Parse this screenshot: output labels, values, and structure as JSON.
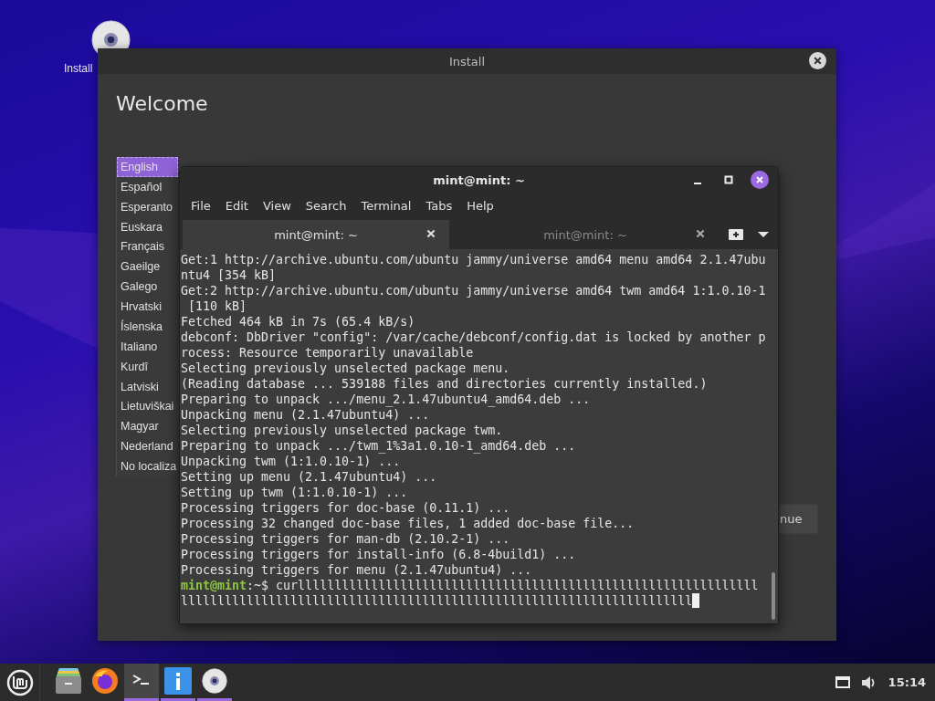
{
  "desktop": {
    "icons": [
      {
        "label": "Install"
      }
    ]
  },
  "installer": {
    "title": "Install",
    "heading": "Welcome",
    "languages": [
      {
        "label": "English",
        "selected": true
      },
      {
        "label": "Español",
        "selected": false
      },
      {
        "label": "Esperanto",
        "selected": false
      },
      {
        "label": "Euskara",
        "selected": false
      },
      {
        "label": "Français",
        "selected": false
      },
      {
        "label": "Gaeilge",
        "selected": false
      },
      {
        "label": "Galego",
        "selected": false
      },
      {
        "label": "Hrvatski",
        "selected": false
      },
      {
        "label": "Íslenska",
        "selected": false
      },
      {
        "label": "Italiano",
        "selected": false
      },
      {
        "label": "Kurdî",
        "selected": false
      },
      {
        "label": "Latviski",
        "selected": false
      },
      {
        "label": "Lietuviškai",
        "selected": false
      },
      {
        "label": "Magyar",
        "selected": false
      },
      {
        "label": "Nederland",
        "selected": false
      },
      {
        "label": "No localiza",
        "selected": false
      }
    ],
    "continue_button": "nue"
  },
  "terminal": {
    "title": "mint@mint: ~",
    "menu": [
      "File",
      "Edit",
      "View",
      "Search",
      "Terminal",
      "Tabs",
      "Help"
    ],
    "tabs": [
      {
        "label": "mint@mint: ~",
        "selected": true
      },
      {
        "label": "mint@mint: ~",
        "selected": false
      }
    ],
    "output": [
      "Get:1 http://archive.ubuntu.com/ubuntu jammy/universe amd64 menu amd64 2.1.47ubu",
      "ntu4 [354 kB]",
      "Get:2 http://archive.ubuntu.com/ubuntu jammy/universe amd64 twm amd64 1:1.0.10-1",
      " [110 kB]",
      "Fetched 464 kB in 7s (65.4 kB/s)",
      "debconf: DbDriver \"config\": /var/cache/debconf/config.dat is locked by another p",
      "rocess: Resource temporarily unavailable",
      "Selecting previously unselected package menu.",
      "(Reading database ... 539188 files and directories currently installed.)",
      "Preparing to unpack .../menu_2.1.47ubuntu4_amd64.deb ...",
      "Unpacking menu (2.1.47ubuntu4) ...",
      "Selecting previously unselected package twm.",
      "Preparing to unpack .../twm_1%3a1.0.10-1_amd64.deb ...",
      "Unpacking twm (1:1.0.10-1) ...",
      "Setting up menu (2.1.47ubuntu4) ...",
      "Setting up twm (1:1.0.10-1) ...",
      "Processing triggers for doc-base (0.11.1) ...",
      "Processing 32 changed doc-base files, 1 added doc-base file...",
      "Processing triggers for man-db (2.10.2-1) ...",
      "Processing triggers for install-info (6.8-4build1) ...",
      "Processing triggers for menu (2.1.47ubuntu4) ..."
    ],
    "prompt": {
      "user": "mint@mint",
      "path": ":~$",
      "command": "curlllllllllllllllllllllllllllllllllllllllllllllllllllllllllllllll"
    },
    "continuation": "llllllllllllllllllllllllllllllllllllllllllllllllllllllllllllllllllllll"
  },
  "taskbar": {
    "apps": [
      {
        "kind": "files",
        "running": false,
        "active": false
      },
      {
        "kind": "browser",
        "running": false,
        "active": false
      },
      {
        "kind": "terminal",
        "running": true,
        "active": true
      },
      {
        "kind": "info",
        "running": true,
        "active": false
      },
      {
        "kind": "disc",
        "running": true,
        "active": false
      }
    ],
    "clock": "15:14"
  }
}
